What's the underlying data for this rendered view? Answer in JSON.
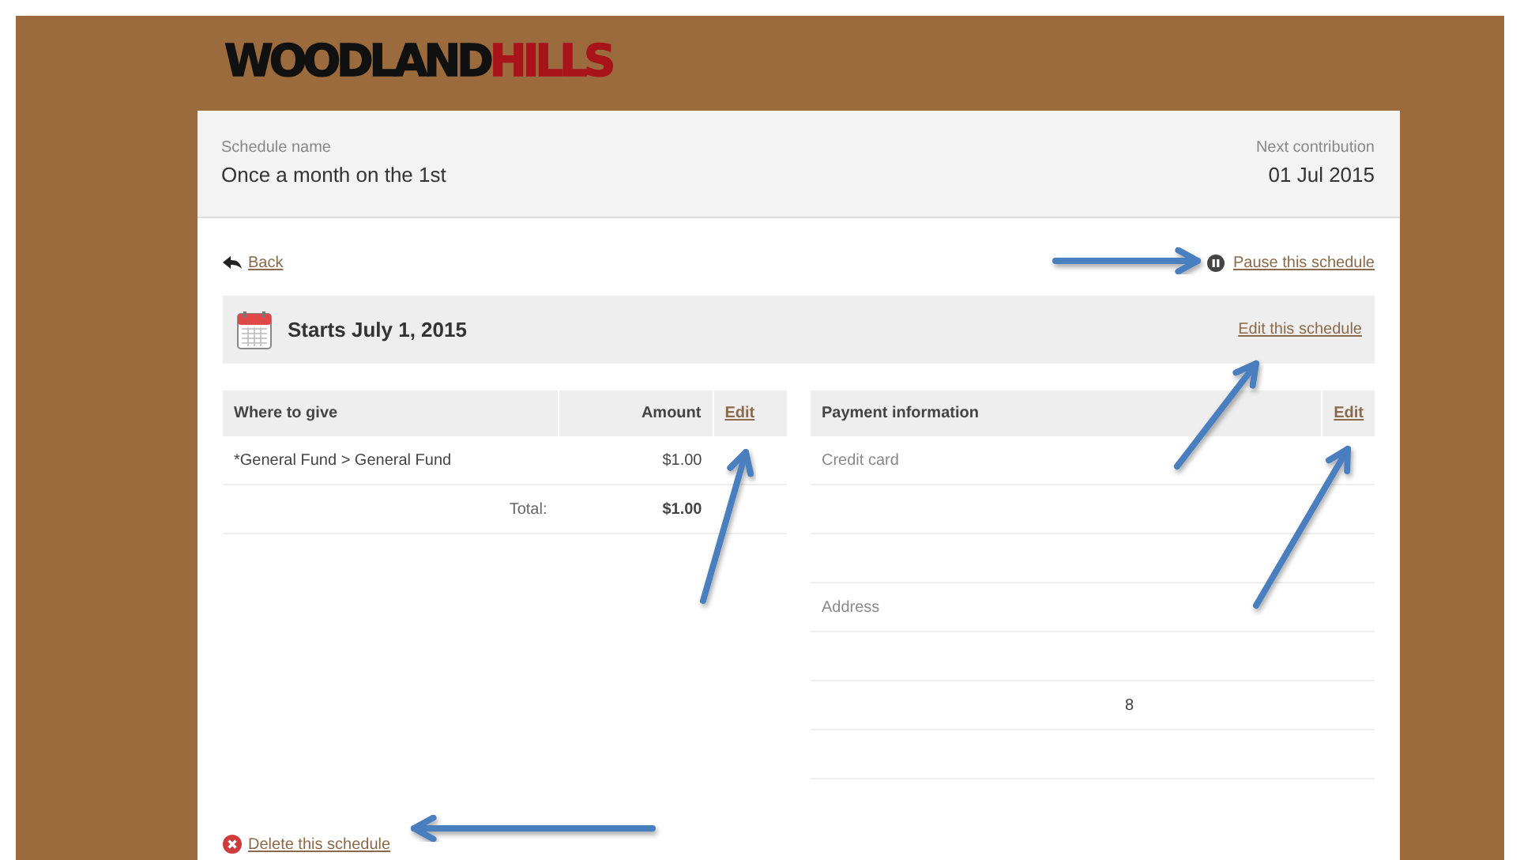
{
  "logo": {
    "part_1": "WOODLAND",
    "part_2": "HILLS"
  },
  "summary": {
    "name_label": "Schedule name",
    "name": "Once a month on the 1st",
    "next_label": "Next contribution",
    "next": "01 Jul 2015"
  },
  "back_link": "Back",
  "pause_link": "Pause this schedule",
  "schedule_bar": {
    "title": "Starts July 1, 2015",
    "edit_link": "Edit this schedule"
  },
  "gifts": {
    "columns": [
      "Where to give",
      "Amount"
    ],
    "edit_link": "Edit",
    "rows": [
      {
        "fund": "*General Fund > General Fund",
        "amount": "$1.00"
      }
    ],
    "total_label": "Total:",
    "total": "$1.00"
  },
  "payment": {
    "title": "Payment information",
    "edit_link": "Edit",
    "rows": [
      {
        "label": "Credit card",
        "value": ""
      },
      {
        "label": "",
        "value": ""
      },
      {
        "label": "",
        "value": ""
      },
      {
        "label": "Address",
        "value": ""
      },
      {
        "label": "",
        "value": ""
      },
      {
        "label": "",
        "value": "8"
      },
      {
        "label": "",
        "value": ""
      }
    ]
  },
  "delete_link": "Delete this schedule"
}
